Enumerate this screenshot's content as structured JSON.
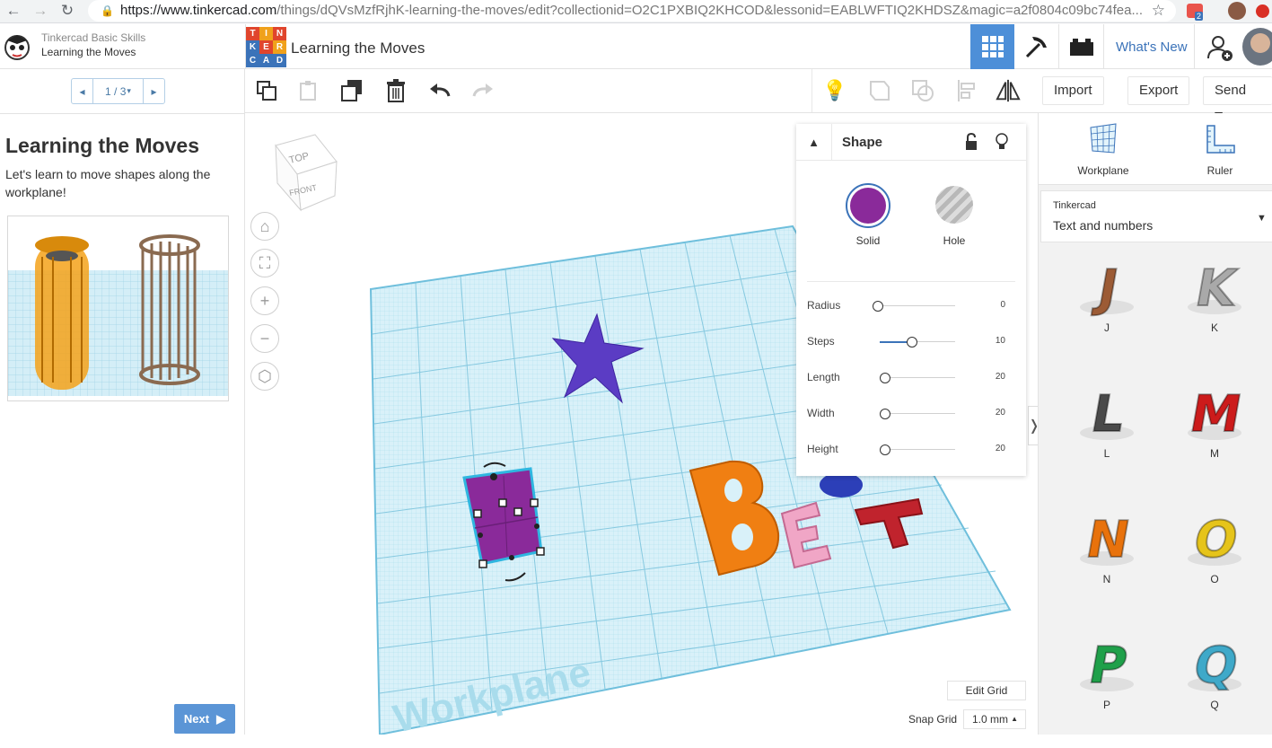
{
  "browser": {
    "url_host": "https://www.tinkercad.com",
    "url_path": "/things/dQVsMzfRjhK-learning-the-moves/edit?collectionid=O2C1PXBIQ2KHCOD&lessonid=EABLWFTIQ2KHDSZ&magic=a2f0804c09bc74fea...",
    "ext_badge": "2"
  },
  "colors": {
    "accent": "#3b73b9",
    "solid": "#8a2a9a",
    "active_tab": "#4d8fd8"
  },
  "lesson": {
    "course": "Tinkercad Basic Skills",
    "name": "Learning the Moves",
    "pager": "1 / 3",
    "heading": "Learning the Moves",
    "desc": "Let's learn to move shapes along the workplane!",
    "next": "Next"
  },
  "app": {
    "logo_letters": [
      "T",
      "I",
      "N",
      "K",
      "E",
      "R",
      "C",
      "A",
      "D"
    ],
    "title": "Learning the Moves",
    "whats_new": "What's New"
  },
  "toolbar": {
    "import": "Import",
    "export": "Export",
    "send_to": "Send To"
  },
  "viewcube": {
    "top": "TOP",
    "front": "FRONT"
  },
  "workplane_label": "Workplane",
  "inspector": {
    "title": "Shape",
    "solid": "Solid",
    "hole": "Hole",
    "params": [
      {
        "label": "Radius",
        "value": "0",
        "level": 0
      },
      {
        "label": "Steps",
        "value": "10",
        "level": 0.45
      },
      {
        "label": "Length",
        "value": "20",
        "level": 0.1
      },
      {
        "label": "Width",
        "value": "20",
        "level": 0.1
      },
      {
        "label": "Height",
        "value": "20",
        "level": 0.1
      }
    ]
  },
  "grid": {
    "edit": "Edit Grid",
    "snap_label": "Snap Grid",
    "snap_value": "1.0 mm"
  },
  "panel": {
    "workplane": "Workplane",
    "ruler": "Ruler",
    "library": "Tinkercad",
    "category": "Text and numbers",
    "shapes": [
      {
        "label": "J",
        "color": "#9c5b35"
      },
      {
        "label": "K",
        "color": "#a9a9a9"
      },
      {
        "label": "L",
        "color": "#4a4a4a"
      },
      {
        "label": "M",
        "color": "#cc1b1b"
      },
      {
        "label": "N",
        "color": "#e8720c"
      },
      {
        "label": "O",
        "color": "#e6c41a"
      },
      {
        "label": "P",
        "color": "#1fa04a"
      },
      {
        "label": "Q",
        "color": "#3fa9c9"
      }
    ]
  }
}
